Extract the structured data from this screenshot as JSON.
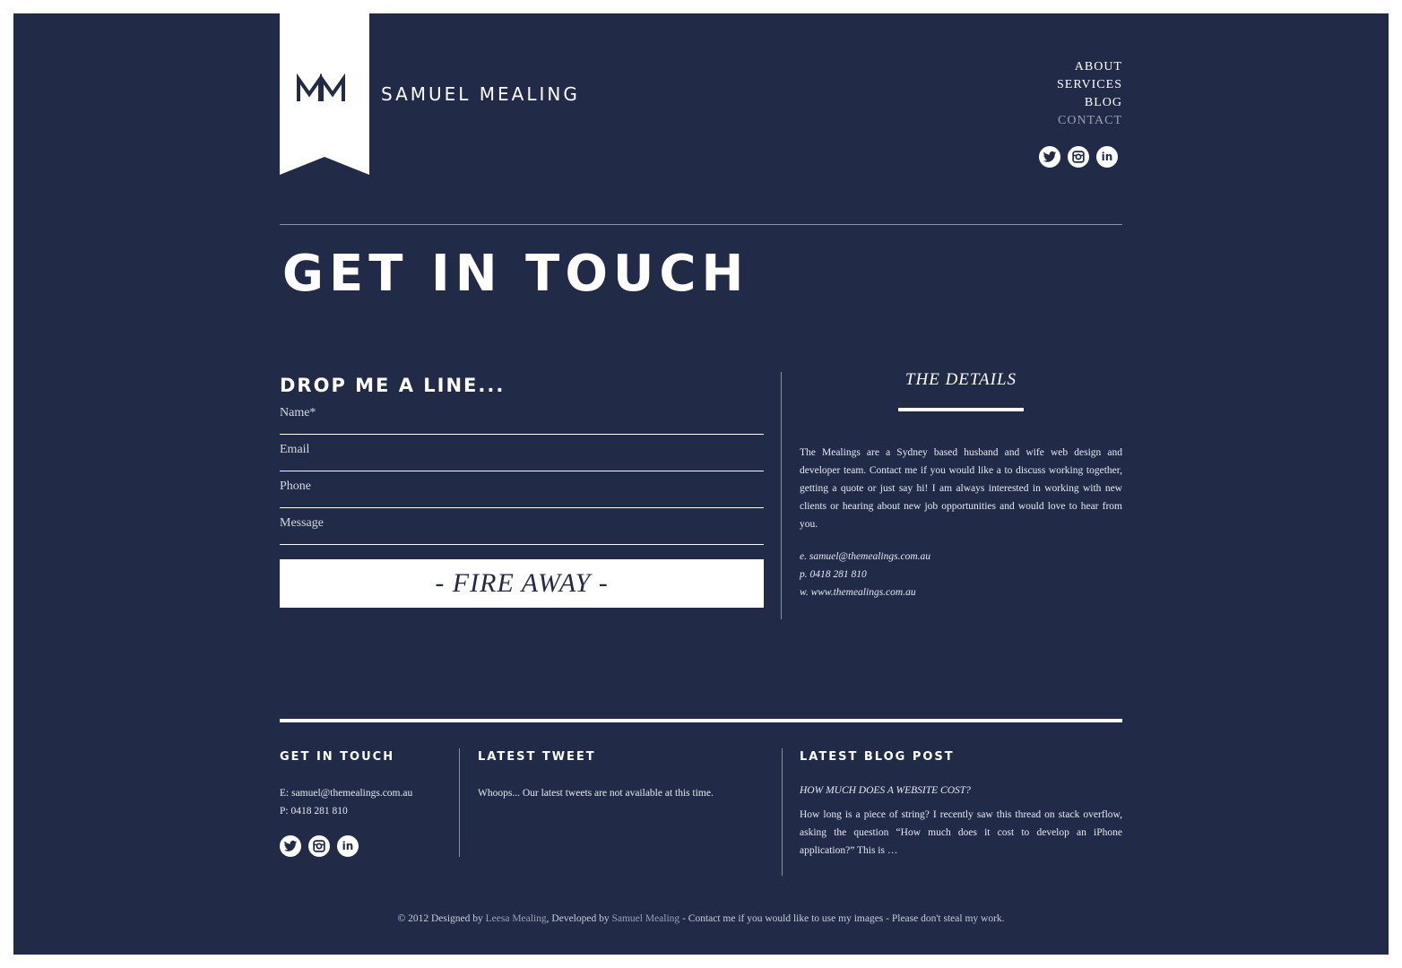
{
  "brand": {
    "monogram": "MM",
    "name": "SAMUEL MEALING"
  },
  "nav": {
    "items": [
      "ABOUT",
      "SERVICES",
      "BLOG",
      "CONTACT"
    ],
    "active": "CONTACT"
  },
  "social": {
    "icons": [
      "twitter-icon",
      "instagram-icon",
      "linkedin-icon"
    ],
    "linkedin_glyph": "in"
  },
  "page": {
    "title": "GET IN TOUCH"
  },
  "form": {
    "title": "DROP ME A LINE...",
    "fields": [
      {
        "placeholder": "Name*"
      },
      {
        "placeholder": "Email"
      },
      {
        "placeholder": "Phone"
      },
      {
        "placeholder": "Message"
      }
    ],
    "submit_label": "- FIRE AWAY -"
  },
  "details": {
    "title": "THE DETAILS",
    "body": "The Mealings are a Sydney based husband and wife web design and developer team. Contact me if you would like a to discuss working together, getting a quote or just say hi! I am always interested in working with new clients or hearing about new job opportunities and would love to hear from you.",
    "email": "e. samuel@themealings.com.au",
    "phone": "p. 0418 281 810",
    "web": "w. www.themealings.com.au"
  },
  "footer": {
    "touch": {
      "title": "GET IN TOUCH",
      "email": "E: samuel@themealings.com.au",
      "phone": "P: 0418 281 810"
    },
    "tweet": {
      "title": "LATEST TWEET",
      "text": "Whoops... Our latest tweets are not available at this time."
    },
    "blog": {
      "title": "LATEST BLOG POST",
      "post_title": "HOW MUCH DOES A WEBSITE COST?",
      "excerpt": "How long is a piece of string? I recently saw this thread on stack overflow, asking the question “How much does it cost to develop an iPhone application?” This is …"
    }
  },
  "copyright": {
    "prefix": "© 2012 Designed by ",
    "designer": "Leesa Mealing",
    "middle": ", Developed by ",
    "developer": "Samuel Mealing",
    "suffix": " - Contact me if you would like to use my images - Please don't steal my work."
  },
  "colors": {
    "background": "#212b48",
    "foreground": "#ffffff",
    "muted": "#9aa0b0",
    "frame": "#ffffff"
  }
}
